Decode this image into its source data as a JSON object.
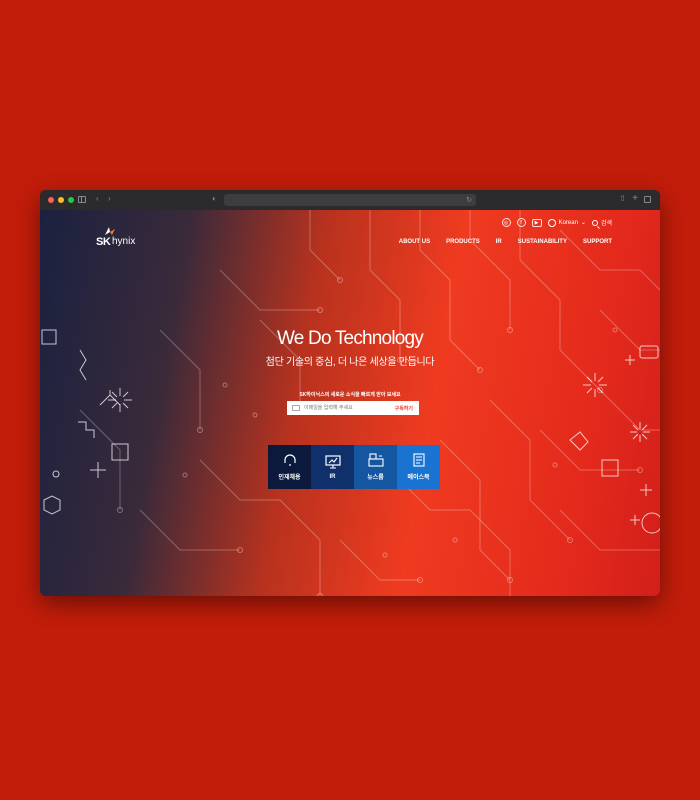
{
  "browser": {
    "traffic_lights": [
      "#ff5f57",
      "#febc2e",
      "#28c840"
    ]
  },
  "brand": {
    "sk": "SK",
    "hynix": "hynix"
  },
  "topbar": {
    "language": "Korean",
    "search_label": "검색",
    "social_icons": [
      "instagram-icon",
      "facebook-icon",
      "youtube-icon"
    ]
  },
  "nav": {
    "items": [
      "ABOUT US",
      "PRODUCTS",
      "IR",
      "SUSTAINABILITY",
      "SUPPORT"
    ]
  },
  "hero": {
    "title": "We Do Technology",
    "subtitle": "첨단 기술의 중심, 더 나은 세상을 만듭니다"
  },
  "newsletter": {
    "label": "SK하이닉스의 새로운 소식을 빠르게 받아 보세요",
    "placeholder": "이메일을 입력해 주세요",
    "button": "구독하기"
  },
  "tiles": [
    {
      "label": "인재채용",
      "icon": "headset-icon",
      "color": "#0b1a3c"
    },
    {
      "label": "IR",
      "icon": "presentation-icon",
      "color": "#10306b"
    },
    {
      "label": "뉴스룸",
      "icon": "newsroom-icon",
      "color": "#14569f"
    },
    {
      "label": "메이스북",
      "icon": "book-icon",
      "color": "#1a73d0"
    }
  ],
  "colors": {
    "page_bg": "#c21d0a",
    "accent": "#e73b28"
  }
}
